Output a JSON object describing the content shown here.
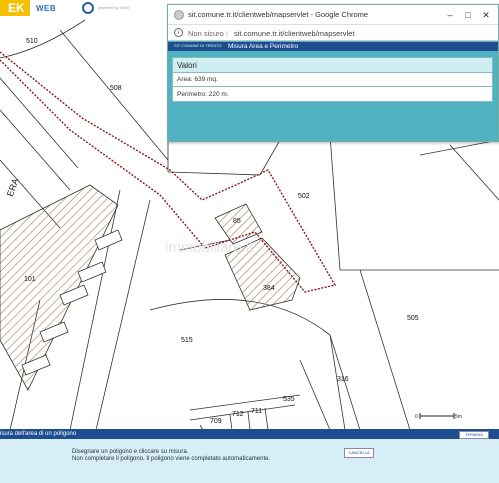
{
  "app": {
    "logo_text": "EK",
    "logo_suffix": "WEB",
    "powered_by": "powered by GSM"
  },
  "popup": {
    "window_title": "sit.comune.tr.it/clientweb/mapservlet - Google Chrome",
    "security_label": "Non sicuro",
    "url": "sit.comune.tr.it/clientweb/mapservlet",
    "toolbar_left": "SIT COMUNE DI TRENTO",
    "toolbar_title": "Misura Area e Perimetro",
    "panel_header": "Valori",
    "area_text": "Area: 639 mq.",
    "perimetro_text": "Perimetro: 220 m.",
    "minimize": "–",
    "maximize": "□",
    "close": "✕"
  },
  "map": {
    "parcel_labels": [
      "510",
      "508",
      "502",
      "85",
      "384",
      "101",
      "505",
      "515",
      "316",
      "535",
      "712",
      "711",
      "709"
    ],
    "street_label": "ERA",
    "watermark": "immobiliare.it",
    "scale_label": "0",
    "scale_unit": "5m",
    "measure_line_color": "#8b1a1a",
    "hatch_color": "#9a7a55"
  },
  "bottom": {
    "title": "isura dell'area di un poligono",
    "close_label": "TERMINA",
    "instruction_1": "Disegnare un poligono e cliccare su misura.",
    "instruction_2": "Non completare il poligono. Il poligono viene completato automaticamente.",
    "cancel_label": "CANCELLA"
  }
}
